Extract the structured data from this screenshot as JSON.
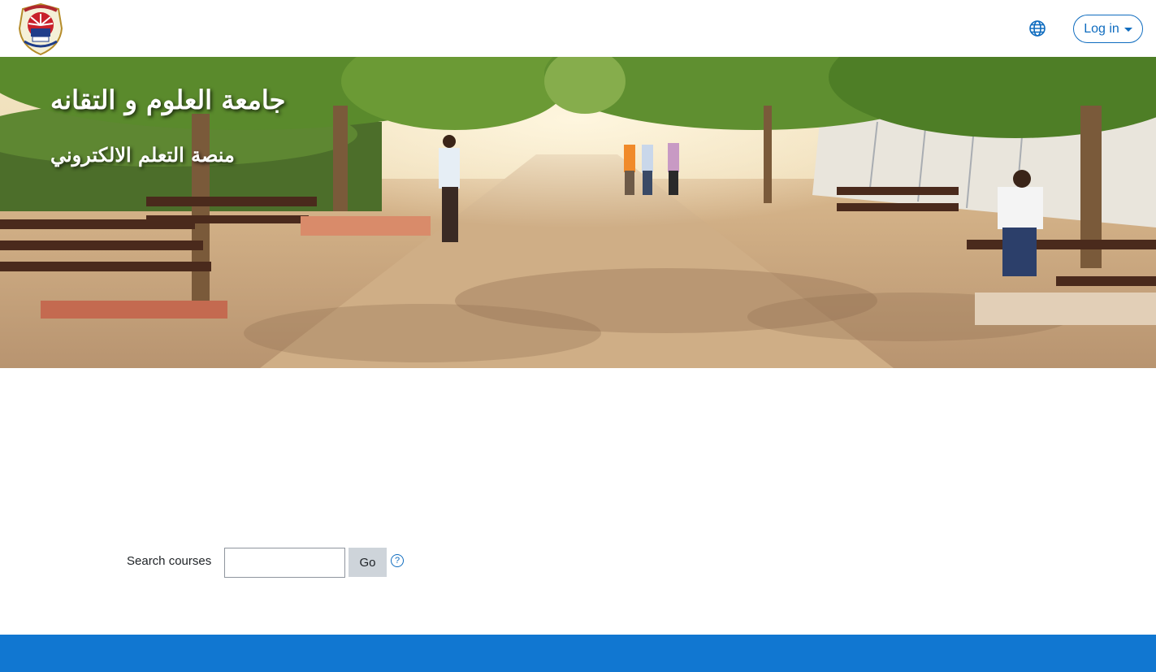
{
  "navbar": {
    "logo_icon": "university-seal-icon",
    "language_icon": "globe-icon",
    "login_label": "Log in"
  },
  "hero": {
    "title": "جامعة العلوم و التقانه",
    "subtitle": "منصة التعلم الالكتروني"
  },
  "search": {
    "label": "Search courses",
    "value": "",
    "placeholder": "",
    "go_label": "Go",
    "help_icon": "question-circle-icon",
    "help_glyph": "?"
  },
  "colors": {
    "accent": "#0f6cbf",
    "footer": "#1177d1",
    "go_button": "#ced4da"
  }
}
